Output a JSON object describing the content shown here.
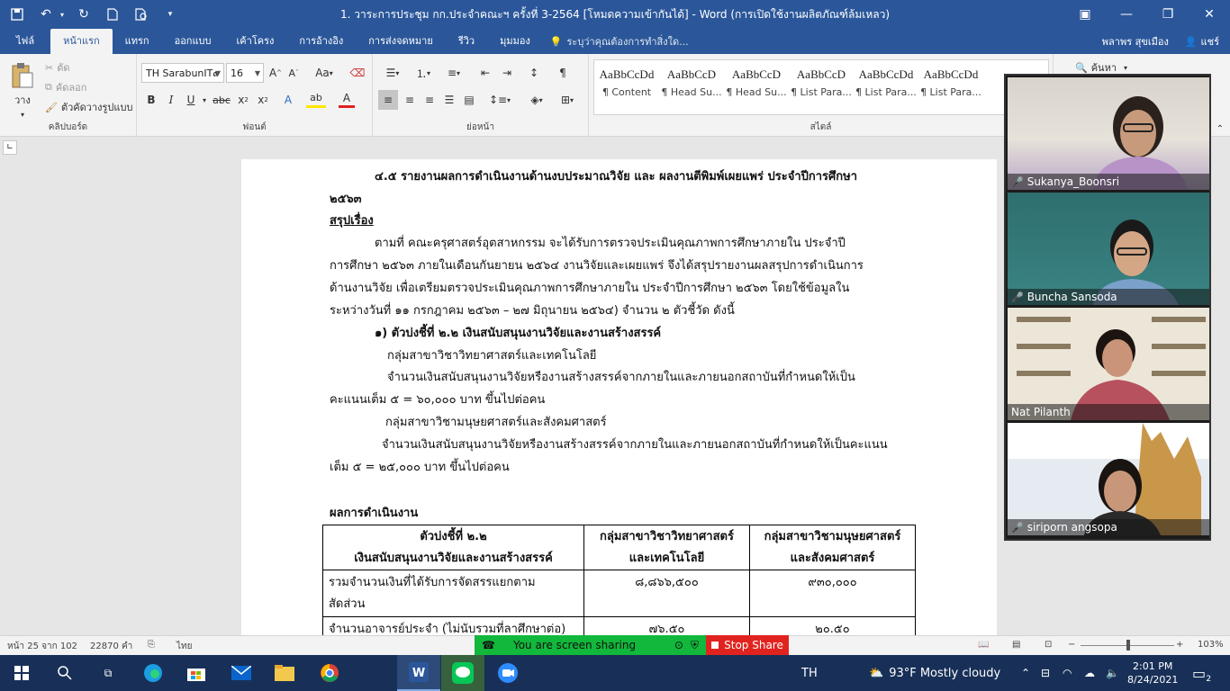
{
  "window": {
    "title": "1. วาระการประชุม กก.ประจำคณะฯ ครั้งที่ 3-2564 [โหมดความเข้ากันได้] - Word (การเปิดใช้งานผลิตภัณฑ์ล้มเหลว)"
  },
  "ribbon_tabs": [
    "ไฟล์",
    "หน้าแรก",
    "แทรก",
    "ออกแบบ",
    "เค้าโครง",
    "การอ้างอิง",
    "การส่งจดหมาย",
    "รีวิว",
    "มุมมอง"
  ],
  "tell_me": "ระบุว่าคุณต้องการทำสิ่งใด...",
  "user": {
    "name": "พลาพร สุขเมือง",
    "share": "แชร์"
  },
  "clipboard": {
    "paste": "วาง",
    "cut": "ตัด",
    "copy": "คัดลอก",
    "format_painter": "ตัวคัดวางรูปแบบ",
    "label": "คลิปบอร์ด"
  },
  "font": {
    "name": "TH SarabunIT๙",
    "size": "16",
    "label": "ฟอนต์",
    "case": "Aa"
  },
  "paragraph": {
    "label": "ย่อหน้า"
  },
  "styles": {
    "label": "สไตล์",
    "items": [
      {
        "sample": "AaBbCcDd",
        "name": "¶ Content"
      },
      {
        "sample": "AaBbCcD",
        "name": "¶ Head Su..."
      },
      {
        "sample": "AaBbCcD",
        "name": "¶ Head Su..."
      },
      {
        "sample": "AaBbCcD",
        "name": "¶ List Para..."
      },
      {
        "sample": "AaBbCcDd",
        "name": "¶ List Para..."
      },
      {
        "sample": "AaBbCcDd",
        "name": "¶ List Para..."
      }
    ]
  },
  "search": {
    "label": "ค้นหา"
  },
  "document": {
    "heading_line1": "๔.๕ รายงานผลการดำเนินงานด้านงบประมาณวิจัย และ ผลงานตีพิมพ์เผยแพร่ ประจำปีการศึกษา",
    "heading_line2": "๒๕๖๓",
    "summary_title": "สรุปเรื่อง",
    "para1": [
      "ตามที่ คณะครุศาสตร์อุตสาหกรรม จะได้รับการตรวจประเมินคุณภาพการศึกษาภายใน ประจำปี",
      "การศึกษา ๒๕๖๓ ภายในเดือนกันยายน ๒๕๖๔ งานวิจัยและเผยแพร่ จึงได้สรุปรายงานผลสรุปการดำเนินการ",
      "ด้านงานวิจัย เพื่อเตรียมตรวจประเมินคุณภาพการศึกษาภายใน ประจำปีการศึกษา ๒๕๖๓ โดยใช้ข้อมูลใน",
      "ระหว่างวันที่ ๑๑ กรกฎาคม ๒๕๖๓ – ๒๗ มิถุนายน ๒๕๖๔) จำนวน ๒  ตัวชี้วัด ดังนี้"
    ],
    "indicator_title": "๑) ตัวบ่งชี้ที่ ๒.๒ เงินสนับสนุนงานวิจัยและงานสร้างสรรค์",
    "group_sci": "กลุ่มสาขาวิชาวิทยาศาสตร์และเทคโนโลยี",
    "sci_text": [
      "จำนวนเงินสนับสนุนงานวิจัยหรืองานสร้างสรรค์จากภายในและภายนอกสถาบันที่กำหนดให้เป็น",
      "คะแนนเต็ม ๕ = ๖๐,๐๐๐ บาท ขึ้นไปต่อคน"
    ],
    "group_hum": "กลุ่มสาขาวิชามนุษยศาสตร์และสังคมศาสตร์",
    "hum_text": [
      "จำนวนเงินสนับสนุนงานวิจัยหรืองานสร้างสรรค์จากภายในและภายนอกสถาบันที่กำหนดให้เป็นคะแนน",
      "เต็ม ๕ = ๒๕,๐๐๐ บาท ขึ้นไปต่อคน"
    ],
    "results_title": "ผลการดำเนินงาน",
    "table": {
      "headers": [
        [
          "ตัวบ่งชี้ที่ ๒.๒",
          "เงินสนับสนุนงานวิจัยและงานสร้างสรรค์"
        ],
        [
          "กลุ่มสาขาวิชาวิทยาศาสตร์",
          "และเทคโนโลยี"
        ],
        [
          "กลุ่มสาขาวิชามนุษยศาสตร์",
          "และสังคมศาสตร์"
        ]
      ],
      "rows": [
        {
          "label": [
            "รวมจำนวนเงินที่ได้รับการจัดสรรแยกตาม",
            "สัดส่วน"
          ],
          "sci": "๘,๘๖๖,๕๐๐",
          "hum": "๙๓๐,๐๐๐"
        },
        {
          "label": [
            "จำนวนอาจารย์ประจำ (ไม่นับรวมที่ลาศึกษาต่อ)"
          ],
          "sci": "๗๖.๕๐",
          "hum": "๒๐.๕๐"
        }
      ]
    }
  },
  "participants": [
    {
      "name": "Sukanya_Boonsri"
    },
    {
      "name": "Buncha Sansoda"
    },
    {
      "name": "Nat Pilanth"
    },
    {
      "name": "siriporn angsopa"
    }
  ],
  "status": {
    "page": "หน้า 25 จาก 102",
    "words": "22870 คำ",
    "language": "ไทย",
    "zoom": "103%"
  },
  "share": {
    "status": "You are screen sharing",
    "stop": "Stop Share"
  },
  "taskbar": {
    "lang": "TH",
    "weather": "93°F  Mostly cloudy",
    "time": "2:01 PM",
    "date": "8/24/2021",
    "notif": "2"
  }
}
